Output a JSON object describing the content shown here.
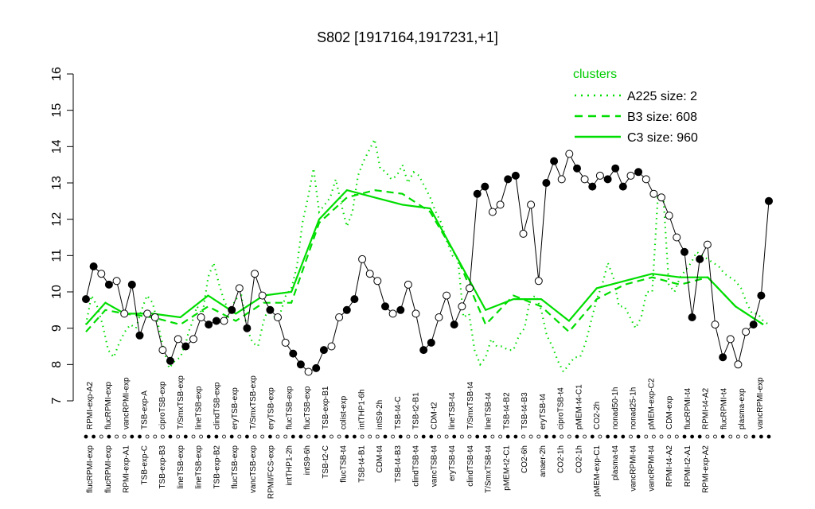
{
  "chart_data": {
    "type": "line",
    "title": "S802 [1917164,1917231,+1]",
    "xlabel": "",
    "ylabel": "",
    "ylim": [
      7,
      16
    ],
    "yticks": [
      7,
      8,
      9,
      10,
      11,
      12,
      13,
      14,
      15,
      16
    ],
    "grid": false,
    "legend": {
      "title": "clusters",
      "placement": "top-right",
      "color": "#00dd00",
      "entries": [
        {
          "label": "A225 size: 2",
          "style": "dotted"
        },
        {
          "label": "B3 size: 608",
          "style": "dashed"
        },
        {
          "label": "C3 size: 960",
          "style": "solid"
        }
      ]
    },
    "top_labels": [
      "RPMI-exp-A2",
      "flucRPMI-exp",
      "vancRPMI-exp",
      "TSB-exp-A",
      "ciproTSB-exp",
      "T/SmxTSB-exp",
      "lineTSB-exp",
      "clindTSB-exp",
      "eryTSB-exp",
      "T/SmxTSB-exp",
      "eryTSB-exp",
      "flucTSB-exp",
      "flucTSB-exp",
      "TSB-exp-B1",
      "colist-exp",
      "intTHP1-6h",
      "intS9-2h",
      "TSB-t4-C",
      "TSB-t2-B1",
      "CDM-t2",
      "lineTSB-t4",
      "T/SmxTSB-t4",
      "lineTSB-t4",
      "TSB-t4-B2",
      "TSB-t4-B3",
      "eryTSB-t4",
      "ciproTSB-t4",
      "pMEM-t4-C1",
      "CO2-2h",
      "nonad50-1h",
      "nonad25-1h",
      "pMEM-exp-C2",
      "CDM-exp",
      "flucRPMI-t4",
      "RPMI-t4-A2",
      "flucRPMI-t4",
      "plasma-exp",
      "vancRPMI-exp"
    ],
    "bottom_labels": [
      "flucRPMI-exp",
      "flucRPMI-exp",
      "RPMI-exp-A1",
      "TSB-exp-C",
      "TSB-exp-B3",
      "lineTSB-exp",
      "lineTSB-exp",
      "TSB-exp-B2",
      "flucTSB-exp",
      "vancTSB-exp",
      "RPMI/FCS-exp",
      "intTHP1-2h",
      "intS9-6h",
      "TSB-t2-C",
      "flucTSB-t4",
      "TSB-t4-B1",
      "CDM-t4",
      "TSB-t4-B3",
      "clindTSB-t4",
      "vancTSB-t4",
      "eryTSB-t4",
      "clindTSB-t4",
      "T/SmxTSB-t4",
      "pMEM-t2-C1",
      "CO2-6h",
      "anaer-2h",
      "CO2-1h",
      "CO2-1h",
      "pMEM-exp-C1",
      "plasma-t4",
      "vancRPMI-t4",
      "vancRPMI-t4",
      "RPMI-t4-A2",
      "RPMI-t2-A1",
      "RPMI-exp-A2"
    ],
    "x_ticks": [
      {
        "x": 1,
        "top": "RPMI-exp-A2",
        "bottom": "flucRPMI-exp"
      },
      {
        "x": 2,
        "top": "flucRPMI-exp",
        "bottom": "flucRPMI-exp"
      },
      {
        "x": 3,
        "top": "vancRPMI-exp",
        "bottom": "RPMI-exp-A1"
      },
      {
        "x": 4,
        "top": "TSB-exp-A",
        "bottom": "TSB-exp-C"
      },
      {
        "x": 5,
        "top": "ciproTSB-exp",
        "bottom": "TSB-exp-B3"
      },
      {
        "x": 6,
        "top": "T/SmxTSB-exp",
        "bottom": "lineTSB-exp"
      },
      {
        "x": 7,
        "top": "lineTSB-exp",
        "bottom": "lineTSB-exp"
      },
      {
        "x": 8,
        "top": "clindTSB-exp",
        "bottom": "TSB-exp-B2"
      },
      {
        "x": 9,
        "top": "eryTSB-exp",
        "bottom": "flucTSB-exp"
      },
      {
        "x": 10,
        "top": "T/SmxTSB-exp",
        "bottom": "vancTSB-exp"
      },
      {
        "x": 11,
        "top": "eryTSB-exp",
        "bottom": "RPMI/FCS-exp"
      },
      {
        "x": 12,
        "top": "flucTSB-exp",
        "bottom": "intTHP1-2h"
      },
      {
        "x": 13,
        "top": "flucTSB-exp",
        "bottom": "intS9-6h"
      },
      {
        "x": 14,
        "top": "TSB-exp-B1",
        "bottom": "TSB-t2-C"
      },
      {
        "x": 15,
        "top": "colist-exp",
        "bottom": "flucTSB-t4"
      },
      {
        "x": 16,
        "top": "intTHP1-6h",
        "bottom": "TSB-t4-B1"
      },
      {
        "x": 17,
        "top": "intS9-2h",
        "bottom": "CDM-t4"
      },
      {
        "x": 18,
        "top": "TSB-t4-C",
        "bottom": "TSB-t4-B3"
      },
      {
        "x": 19,
        "top": "TSB-t2-B1",
        "bottom": "clindTSB-t4"
      },
      {
        "x": 20,
        "top": "CDM-t2",
        "bottom": "vancTSB-t4"
      },
      {
        "x": 21,
        "top": "lineTSB-t4",
        "bottom": "eryTSB-t4"
      },
      {
        "x": 22,
        "top": "T/SmxTSB-t4",
        "bottom": "clindTSB-t4"
      },
      {
        "x": 23,
        "top": "lineTSB-t4",
        "bottom": "T/SmxTSB-t4"
      },
      {
        "x": 24,
        "top": "TSB-t4-B2",
        "bottom": "pMEM-t2-C1"
      },
      {
        "x": 25,
        "top": "TSB-t4-B3",
        "bottom": "CO2-6h"
      },
      {
        "x": 26,
        "top": "eryTSB-t4",
        "bottom": "anaer-2h"
      },
      {
        "x": 27,
        "top": "ciproTSB-t4",
        "bottom": "CO2-1h"
      },
      {
        "x": 28,
        "top": "pMEM-t4-C1",
        "bottom": "CO2-1h"
      },
      {
        "x": 29,
        "top": "CO2-2h",
        "bottom": "pMEM-exp-C1"
      },
      {
        "x": 30,
        "top": "nonad50-1h",
        "bottom": "plasma-t4"
      },
      {
        "x": 31,
        "top": "nonad25-1h",
        "bottom": "vancRPMI-t4"
      },
      {
        "x": 32,
        "top": "pMEM-exp-C2",
        "bottom": "vancRPMI-t4"
      },
      {
        "x": 33,
        "top": "CDM-exp",
        "bottom": "RPMI-t4-A2"
      },
      {
        "x": 34,
        "top": "flucRPMI-t4",
        "bottom": "RPMI-t2-A1"
      },
      {
        "x": 35,
        "top": "RPMI-t4-A2",
        "bottom": "RPMI-exp-A2"
      },
      {
        "x": 36,
        "top": "flucRPMI-t4",
        "bottom": ""
      },
      {
        "x": 37,
        "top": "plasma-exp",
        "bottom": ""
      },
      {
        "x": 38,
        "top": "vancRPMI-exp",
        "bottom": ""
      }
    ],
    "series": [
      {
        "name": "A225 size: 2",
        "style": "dotted",
        "color": "#00dd00",
        "x": [
          1,
          3,
          5,
          7,
          9,
          11,
          13,
          15,
          17,
          19,
          21,
          23,
          25,
          27,
          29,
          31,
          33,
          35,
          37,
          38,
          39,
          41,
          43,
          45,
          47,
          49,
          51,
          53,
          55,
          57,
          59,
          61,
          63,
          65,
          67,
          69,
          71,
          73,
          75,
          77,
          79,
          81,
          83,
          85,
          87,
          89,
          91,
          93,
          95,
          97,
          99,
          101,
          103,
          105,
          107,
          109,
          111,
          113,
          115,
          117,
          119,
          121,
          123,
          125,
          127,
          129,
          131,
          133,
          135,
          137,
          139,
          141,
          143,
          145,
          147,
          149,
          151,
          153,
          155,
          157,
          159,
          161,
          163,
          165,
          167,
          169,
          171,
          173,
          175,
          177,
          179,
          181,
          183,
          185,
          187,
          189,
          191,
          193,
          195,
          197,
          199,
          201,
          203,
          205,
          207,
          209,
          211,
          213,
          215,
          217,
          219,
          221,
          223,
          225,
          227,
          229,
          231,
          233,
          235,
          237,
          239,
          241,
          243,
          245,
          247
        ],
        "y": [
          9.1,
          9.9,
          9.6,
          9.1,
          8.4,
          8.2,
          8.6,
          8.9,
          9.1,
          9.0,
          9.5,
          9.9,
          9.7,
          9.1,
          8.4,
          7.9,
          8.1,
          8.2,
          8.6,
          8.9,
          9.1,
          9.6,
          9.4,
          10.4,
          10.8,
          10.2,
          9.7,
          9.5,
          9.8,
          9.9,
          9.0,
          8.6,
          8.5,
          9.2,
          9.6,
          9.3,
          9.4,
          9.9,
          10.1,
          10.7,
          11.9,
          12.6,
          13.4,
          12.2,
          12.4,
          12.6,
          13.1,
          12.4,
          11.8,
          12.2,
          13.2,
          13.6,
          13.9,
          14.2,
          13.4,
          13.3,
          13.1,
          13.2,
          13.5,
          13.0,
          13.3,
          13.2,
          12.9,
          12.6,
          12.2,
          11.9,
          11.4,
          11.0,
          10.9,
          9.3,
          9.4,
          8.4,
          8.0,
          8.2,
          8.7,
          8.5,
          8.5,
          8.4,
          8.4,
          8.8,
          9.0,
          9.8,
          9.9,
          9.5,
          8.8,
          8.5,
          8.1,
          7.8,
          8.0,
          8.2,
          8.2,
          8.6,
          9.2,
          9.8,
          10.2,
          10.8,
          10.4,
          9.6,
          9.6,
          9.3,
          9.0,
          9.3,
          10.0,
          10.0,
          12.6,
          12.6,
          10.2,
          10.0,
          10.4,
          10.6,
          10.8,
          11.1,
          11.0,
          10.9,
          10.8,
          10.7,
          10.5,
          10.4,
          10.3,
          10.1,
          9.7,
          9.4,
          9.4,
          9.2,
          9.1
        ]
      },
      {
        "name": "B3 size: 608",
        "style": "dashed",
        "color": "#00dd00",
        "x": [
          1,
          8,
          15,
          25,
          35,
          45,
          55,
          65,
          75,
          85,
          95,
          105,
          115,
          125,
          135,
          145,
          155,
          165,
          175,
          185,
          195,
          205,
          215,
          225,
          235,
          245
        ],
        "y": [
          8.9,
          9.5,
          9.4,
          9.3,
          9.1,
          9.6,
          9.2,
          9.7,
          9.7,
          11.9,
          12.6,
          12.8,
          12.7,
          12.2,
          10.9,
          9.1,
          9.9,
          9.6,
          8.9,
          9.8,
          10.2,
          10.4,
          10.2,
          10.4,
          9.6,
          9.1
        ]
      },
      {
        "name": "C3 size: 960",
        "style": "solid",
        "color": "#00dd00",
        "x": [
          1,
          8,
          15,
          25,
          35,
          45,
          55,
          65,
          75,
          85,
          95,
          105,
          115,
          125,
          135,
          145,
          155,
          165,
          175,
          185,
          195,
          205,
          215,
          225,
          235,
          245
        ],
        "y": [
          9.1,
          9.7,
          9.4,
          9.4,
          9.3,
          9.9,
          9.4,
          9.9,
          10.0,
          12.0,
          12.8,
          12.6,
          12.4,
          12.3,
          10.9,
          9.5,
          9.8,
          9.8,
          9.2,
          10.1,
          10.3,
          10.5,
          10.4,
          10.4,
          9.6,
          9.1
        ]
      }
    ],
    "points": {
      "x": [
        1,
        2,
        3,
        4,
        5,
        6,
        7,
        8,
        9,
        10,
        11,
        12,
        13,
        14,
        15,
        16,
        17,
        18,
        19,
        20,
        21,
        22,
        23,
        24,
        25,
        26,
        27,
        28,
        29,
        30,
        31,
        32,
        33,
        34,
        35,
        36,
        37,
        38,
        39,
        40,
        41,
        42,
        43,
        44,
        45,
        46,
        47,
        48,
        49,
        50,
        51,
        52,
        53,
        54,
        55,
        56,
        57,
        58,
        59,
        60,
        61,
        62,
        63,
        64,
        65,
        66,
        67,
        68,
        69,
        70,
        71,
        72,
        73,
        74,
        75,
        76,
        77,
        78,
        79,
        80,
        81,
        82,
        83,
        84,
        85,
        86,
        87,
        88,
        89,
        90
      ],
      "y": [
        9.8,
        10.7,
        10.5,
        10.2,
        10.3,
        9.4,
        10.2,
        8.8,
        9.4,
        9.3,
        8.4,
        8.1,
        8.7,
        8.5,
        8.7,
        9.3,
        9.1,
        9.2,
        9.2,
        9.5,
        10.1,
        9.0,
        10.5,
        9.9,
        9.5,
        9.3,
        8.6,
        8.3,
        8.0,
        7.8,
        7.9,
        8.4,
        8.5,
        9.3,
        9.5,
        9.8,
        10.9,
        10.5,
        10.3,
        9.6,
        9.4,
        9.5,
        10.2,
        9.4,
        8.4,
        8.6,
        9.3,
        9.9,
        9.1,
        9.6,
        10.1,
        12.7,
        12.9,
        12.2,
        12.4,
        13.1,
        13.2,
        11.6,
        12.4,
        10.3,
        13.0,
        13.6,
        13.1,
        13.8,
        13.4,
        13.1,
        12.9,
        13.2,
        13.1,
        13.4,
        12.9,
        13.2,
        13.3,
        13.1,
        12.7,
        12.6,
        12.1,
        11.5,
        11.1,
        9.3,
        10.9,
        11.3,
        9.1,
        8.2,
        8.7,
        8.0,
        8.9,
        9.1,
        9.9,
        12.5
      ],
      "filled": [
        true,
        true,
        false,
        true,
        false,
        false,
        true,
        true,
        false,
        false,
        false,
        true,
        false,
        true,
        false,
        false,
        true,
        true,
        false,
        true,
        false,
        true,
        false,
        false,
        true,
        false,
        false,
        true,
        true,
        false,
        true,
        true,
        false,
        false,
        true,
        true,
        false,
        false,
        false,
        true,
        false,
        true,
        false,
        false,
        true,
        true,
        false,
        false,
        true,
        false,
        false,
        true,
        true,
        false,
        false,
        true,
        true,
        false,
        false,
        false,
        true,
        true,
        false,
        false,
        true,
        false,
        true,
        false,
        true,
        true,
        true,
        false,
        true,
        false,
        false,
        false,
        false,
        false,
        true,
        true,
        true,
        false,
        false,
        true,
        false,
        false,
        false,
        true,
        true,
        true
      ]
    }
  }
}
